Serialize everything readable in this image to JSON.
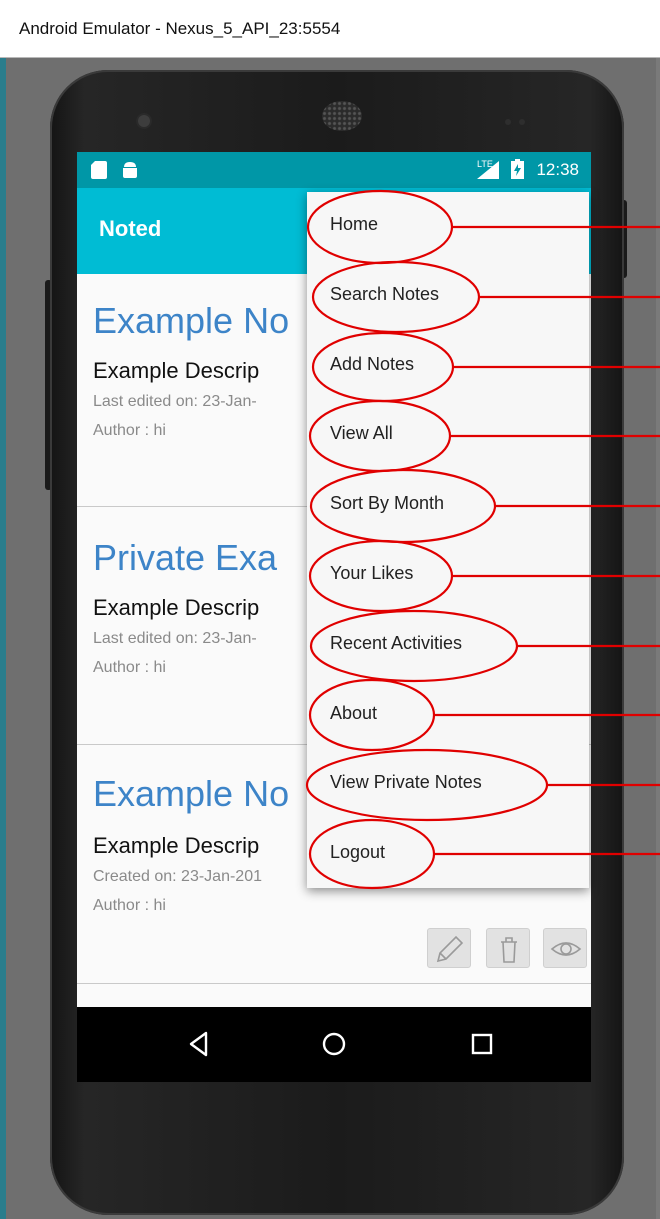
{
  "window": {
    "title": "Android Emulator - Nexus_5_API_23:5554"
  },
  "status_bar": {
    "time": "12:38",
    "network": "LTE"
  },
  "app_bar": {
    "title": "Noted"
  },
  "cards": [
    {
      "title": "Example No",
      "description": "Example Descrip",
      "meta": "Last edited on: 23-Jan-",
      "author": "Author : hi"
    },
    {
      "title": "Private Exa",
      "description": "Example Descrip",
      "meta": "Last edited on: 23-Jan-",
      "author": "Author : hi"
    },
    {
      "title": "Example No",
      "description": "Example Descrip",
      "meta": "Created on: 23-Jan-201",
      "author": "Author : hi"
    }
  ],
  "card_actions": [
    {
      "icon": "pencil-icon"
    },
    {
      "icon": "trash-icon"
    },
    {
      "icon": "eye-icon"
    }
  ],
  "menu": {
    "items": [
      {
        "label": "Home"
      },
      {
        "label": "Search Notes"
      },
      {
        "label": "Add Notes"
      },
      {
        "label": "View All"
      },
      {
        "label": "Sort By Month"
      },
      {
        "label": "Your Likes"
      },
      {
        "label": "Recent Activities"
      },
      {
        "label": "About"
      },
      {
        "label": "View Private Notes"
      },
      {
        "label": "Logout"
      }
    ]
  },
  "nav_bar": {
    "buttons": [
      "back-icon",
      "home-icon",
      "recents-icon"
    ]
  },
  "colors": {
    "status_bar": "#0097a7",
    "app_bar": "#00bcd4",
    "card_title": "#3d84c8",
    "annotation": "#e00000"
  }
}
